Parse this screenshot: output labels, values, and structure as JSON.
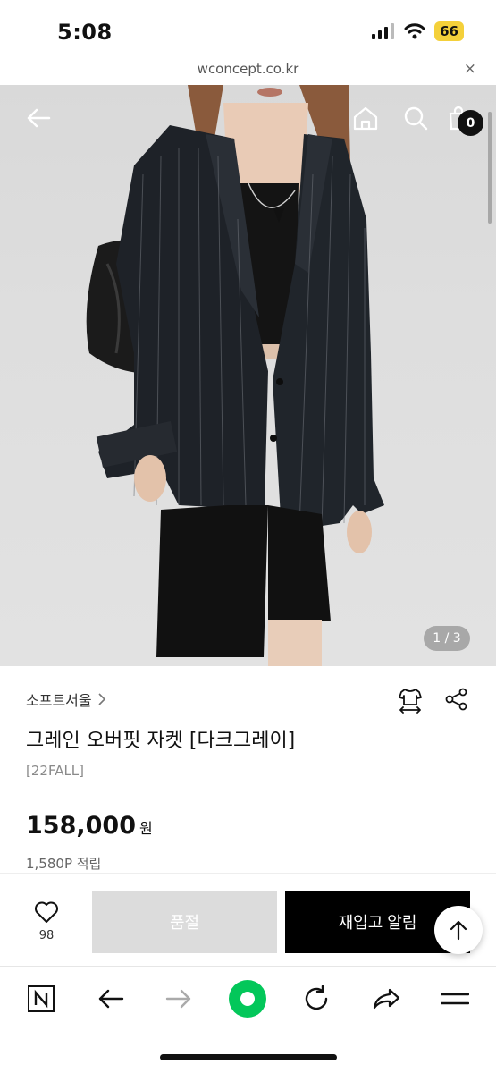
{
  "status_bar": {
    "time": "5:08",
    "battery": "66"
  },
  "url_bar": {
    "url": "wconcept.co.kr",
    "close_symbol": "×"
  },
  "header": {
    "cart_count": "0"
  },
  "hero": {
    "image_counter": "1 / 3"
  },
  "product": {
    "brand": "소프트서울",
    "title": "그레인 오버핏 자켓 [다크그레이]",
    "season": "[22FALL]",
    "price": "158,000",
    "currency": "원",
    "points": "1,580P 적립"
  },
  "actions": {
    "like_count": "98",
    "soldout_label": "품절",
    "restock_label": "재입고 알림"
  },
  "colors": {
    "accent_black": "#000000",
    "soldout_gray": "#dcdcdc",
    "battery_yellow": "#f4d03a",
    "naver_green": "#03c75a"
  }
}
